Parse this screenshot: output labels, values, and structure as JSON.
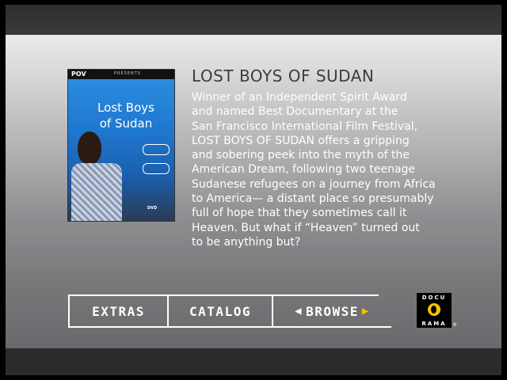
{
  "title": "LOST BOYS OF SUDAN",
  "description": "Winner of an Independent Spirit Award\nand named Best Documentary at the\nSan Francisco International Film Festival,\nLOST BOYS OF SUDAN offers a gripping\nand sobering peek into the myth of the\nAmerican Dream, following two teenage\nSudanese refugees on a journey from Africa\nto America— a distant place so presumably\nfull of hope that they sometimes call it\nHeaven.  But what if “Heaven” turned out\nto be anything but?",
  "poster": {
    "network": "POV",
    "presents": "PRESENTS",
    "title_line1": "Lost Boys",
    "title_line2": "of Sudan",
    "dvd": "DVD"
  },
  "nav": {
    "extras": "EXTRAS",
    "catalog": "CATALOG",
    "browse": "BROWSE",
    "arrow_left": "◀",
    "arrow_right": "▶"
  },
  "logo": {
    "top": "DOCU",
    "bottom": "RAMA",
    "reg": "®"
  },
  "colors": {
    "accent": "#f2c400",
    "title": "#3c3c3c",
    "text": "#ffffff"
  }
}
